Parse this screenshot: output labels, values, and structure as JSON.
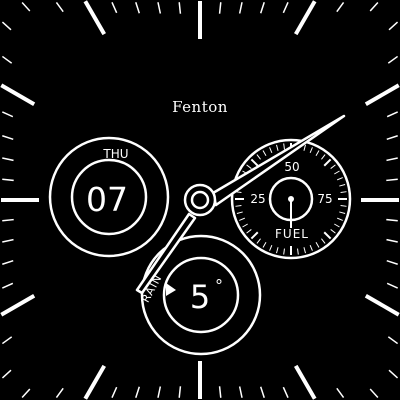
{
  "watch": {
    "brand": "Fenton",
    "date": {
      "day": "THU",
      "number": "07"
    },
    "fuel": {
      "label": "FUEL",
      "scale": [
        "25",
        "50",
        "75"
      ],
      "level_percent": 50
    },
    "weather": {
      "label": "RAIN",
      "temperature": "5",
      "unit": "°"
    }
  },
  "colors": {
    "background": "#000000",
    "foreground": "#ffffff"
  },
  "icons": [
    "minute-track",
    "hour-hand",
    "minute-hand",
    "center-hub",
    "fuel-gauge-needle",
    "rain-indicator-icon"
  ]
}
